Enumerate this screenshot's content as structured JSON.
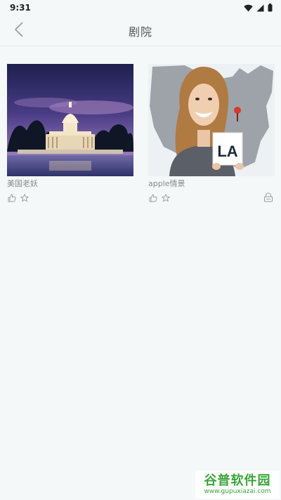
{
  "status_bar": {
    "time": "9:31",
    "icons": [
      "wifi-icon",
      "signal-icon",
      "battery-icon"
    ]
  },
  "header": {
    "title": "剧院",
    "back_icon": "chevron-left-icon"
  },
  "items": [
    {
      "title": "美国老妖",
      "image": "capitol-building-at-dusk",
      "actions": [
        "thumbs-up-icon",
        "star-icon"
      ],
      "locked": false
    },
    {
      "title": "apple情景",
      "image": "woman-holding-la-sign-us-map",
      "actions": [
        "thumbs-up-icon",
        "star-icon"
      ],
      "locked": true
    }
  ],
  "thumb_text": {
    "la_sign": "LA"
  },
  "watermark": {
    "title": "谷普软件园",
    "url": "www.gupuxiazai.com"
  },
  "colors": {
    "background": "#f4f8f9",
    "title_text": "#555555",
    "caption_text": "#8a8a8a",
    "icon_gray": "#999999",
    "watermark_green": "#3aa53a"
  }
}
